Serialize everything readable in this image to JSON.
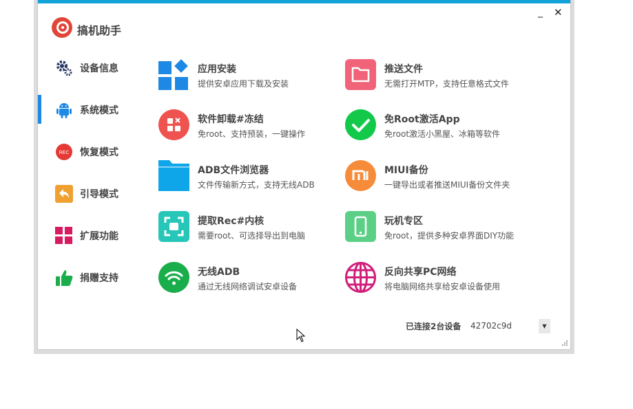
{
  "app": {
    "title": "搞机助手"
  },
  "window_controls": {
    "minimize": "_",
    "close": "✕"
  },
  "sidebar": {
    "items": [
      {
        "label": "设备信息",
        "icon": "gears-icon",
        "active": false
      },
      {
        "label": "系统模式",
        "icon": "android-icon",
        "active": true
      },
      {
        "label": "恢复模式",
        "icon": "rec-icon",
        "active": false
      },
      {
        "label": "引导模式",
        "icon": "back-arrow-icon",
        "active": false
      },
      {
        "label": "扩展功能",
        "icon": "grid-icon",
        "active": false
      },
      {
        "label": "捐赠支持",
        "icon": "thumbs-up-icon",
        "active": false
      }
    ]
  },
  "features": {
    "left": [
      {
        "title": "应用安装",
        "desc": "提供安卓应用下载及安装",
        "icon": "app-install-icon",
        "color": "#1e88e5"
      },
      {
        "title": "软件卸载#冻结",
        "desc": "免root、支持预装，一键操作",
        "icon": "uninstall-icon",
        "color": "#ef5350"
      },
      {
        "title": "ADB文件浏览器",
        "desc": "文件传输新方式，支持无线ADB",
        "icon": "folder-icon",
        "color": "#0ea5e9"
      },
      {
        "title": "提取Rec#内核",
        "desc": "需要root、可选择导出到电脑",
        "icon": "extract-icon",
        "color": "#26c6b9"
      },
      {
        "title": "无线ADB",
        "desc": "通过无线网络调试安卓设备",
        "icon": "wifi-icon",
        "color": "#1aad4b"
      }
    ],
    "right": [
      {
        "title": "推送文件",
        "desc": "无需打开MTP，支持任意格式文件",
        "icon": "push-folder-icon",
        "color": "#f06378"
      },
      {
        "title": "免Root激活App",
        "desc": "免root激活小黑屋、冰箱等软件",
        "icon": "check-icon",
        "color": "#13c94a"
      },
      {
        "title": "MIUI备份",
        "desc": "一键导出或者推送MIUI备份文件夹",
        "icon": "mi-icon",
        "color": "#f68b3a"
      },
      {
        "title": "玩机专区",
        "desc": "免root，提供多种安卓界面DIY功能",
        "icon": "phone-icon",
        "color": "#5ccf86"
      },
      {
        "title": "反向共享PC网络",
        "desc": "将电脑网络共享给安卓设备使用",
        "icon": "globe-icon",
        "color": "#d11f7a"
      }
    ]
  },
  "status": {
    "label": "已连接2台设备",
    "device_value": "42702c9d"
  },
  "colors": {
    "accent": "#12a3d8",
    "active_bar": "#1e88e5"
  }
}
